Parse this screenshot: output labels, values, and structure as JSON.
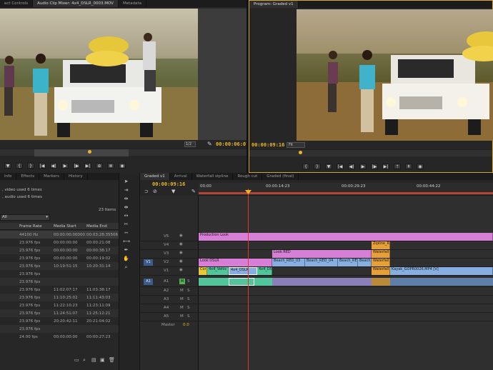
{
  "source_monitor": {
    "tabs": [
      "ect Controls",
      "Audio Clip Mixer: 4x4_DSLR_0003.MOV",
      "Metadata"
    ],
    "fit": "1/2",
    "timecode": "00:00:06:07"
  },
  "program_monitor": {
    "tab": "Program: Graded v1",
    "timecode": "00:00:09:16",
    "fit": "Fit"
  },
  "project_panel": {
    "tabs": [
      "Info",
      "Effects",
      "Markers",
      "History"
    ],
    "usage_lines": [
      ", video used 6 times",
      ", audio used 6 times"
    ],
    "item_count": "23 Items",
    "filter": "All",
    "columns": [
      "Frame Rate",
      "Media Start",
      "Media End"
    ],
    "rows": [
      [
        "44100 Hz",
        "00:00:00:00000",
        "00:03:28:35506"
      ],
      [
        "23.976 fps",
        "00:00:00:00",
        "00:00:21:08"
      ],
      [
        "23.976 fps",
        "00:00:00:00",
        "00:00:38:17"
      ],
      [
        "23.976 fps",
        "00:00:00:00",
        "00:00:19:02"
      ],
      [
        "23.976 fps",
        "10:19:51:15",
        "10:20:31:14"
      ],
      [
        "23.976 fps",
        "",
        ""
      ],
      [
        "23.976 fps",
        "",
        ""
      ],
      [
        "23.976 fps",
        "11:02:07:17",
        "11:03:38:17"
      ],
      [
        "23.976 fps",
        "11:10:25:02",
        "11:11:43:03"
      ],
      [
        "23.976 fps",
        "11:22:10:23",
        "11:23:11:09"
      ],
      [
        "23.976 fps",
        "11:24:51:07",
        "11:25:12:21"
      ],
      [
        "23.976 fps",
        "20:20:42:11",
        "20:21:04:02"
      ],
      [
        "23.976 fps",
        "",
        ""
      ],
      [
        "24.00 fps",
        "00:00:00:00",
        "00:00:27:23"
      ]
    ]
  },
  "timeline": {
    "tabs": [
      "Graded v1",
      "Arrival",
      "Waterfall stpline",
      "Rough cut",
      "Graded (final)"
    ],
    "timecode": "00:00:09:16",
    "ruler": [
      "00:00",
      "00:00:14:23",
      "00:00:29:23",
      "00:00:44:22"
    ],
    "video_tracks": [
      "V5",
      "V4",
      "V3",
      "V2",
      "V1"
    ],
    "audio_tracks": [
      "A1",
      "A2",
      "A3",
      "A4",
      "A5"
    ],
    "master_label": "Master",
    "master_value": "0.0",
    "clips": {
      "production_look": "Production Look",
      "zipline": "Zipline_R",
      "look_red": "Look RED",
      "waterfall_v4": "Waterfall",
      "look_dslr": "Look DSLR",
      "beach_1": "Beach_RED_03",
      "beach_2": "Beach_RED_04",
      "beach_3": "Beach_RE",
      "beach_4": "Beach",
      "waterfall_v2": "Waterfall",
      "c1": "Cor",
      "c2": "4x4_Vehic",
      "c3": "4x4_DSLR",
      "c4": "4x4_DS",
      "waterfall_v1": "Waterfall",
      "kayak": "Kayak_GOPR0026.MP4 [V]"
    }
  },
  "colors": {
    "timecode_yellow": "#e9b526",
    "playhead_red": "#d53d33",
    "adjustment_pink": "#d77ed6",
    "video_clip_blue": "#86aee0",
    "audio_clip_green": "#52c59a",
    "orange_clip": "#e7a036"
  }
}
